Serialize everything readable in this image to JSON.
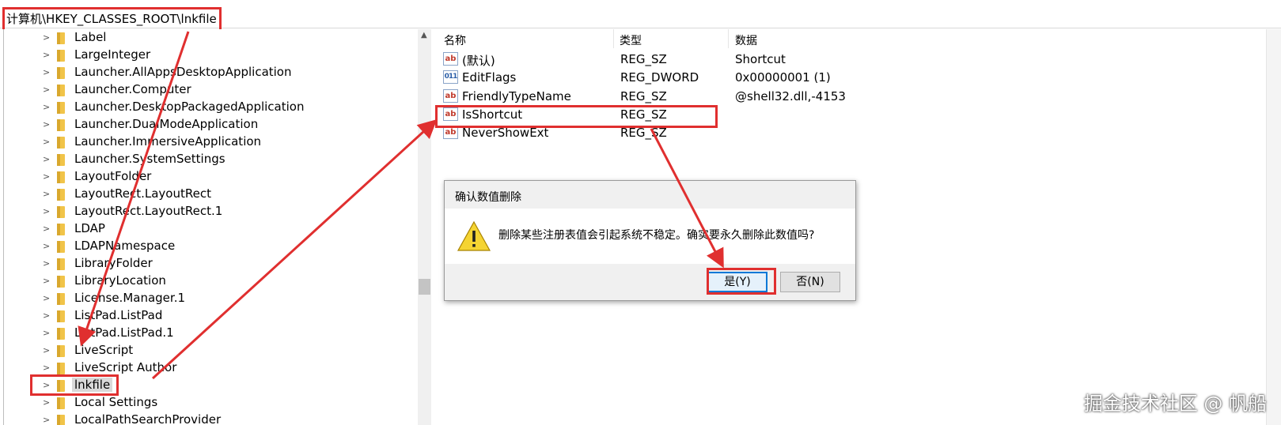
{
  "address": {
    "path": "计算机\\HKEY_CLASSES_ROOT\\lnkfile"
  },
  "tree": {
    "items": [
      {
        "label": "Label",
        "selected": false
      },
      {
        "label": "LargeInteger",
        "selected": false
      },
      {
        "label": "Launcher.AllAppsDesktopApplication",
        "selected": false
      },
      {
        "label": "Launcher.Computer",
        "selected": false
      },
      {
        "label": "Launcher.DesktopPackagedApplication",
        "selected": false
      },
      {
        "label": "Launcher.DualModeApplication",
        "selected": false
      },
      {
        "label": "Launcher.ImmersiveApplication",
        "selected": false
      },
      {
        "label": "Launcher.SystemSettings",
        "selected": false
      },
      {
        "label": "LayoutFolder",
        "selected": false
      },
      {
        "label": "LayoutRect.LayoutRect",
        "selected": false
      },
      {
        "label": "LayoutRect.LayoutRect.1",
        "selected": false
      },
      {
        "label": "LDAP",
        "selected": false
      },
      {
        "label": "LDAPNamespace",
        "selected": false
      },
      {
        "label": "LibraryFolder",
        "selected": false
      },
      {
        "label": "LibraryLocation",
        "selected": false
      },
      {
        "label": "License.Manager.1",
        "selected": false
      },
      {
        "label": "ListPad.ListPad",
        "selected": false
      },
      {
        "label": "ListPad.ListPad.1",
        "selected": false
      },
      {
        "label": "LiveScript",
        "selected": false
      },
      {
        "label": "LiveScript Author",
        "selected": false
      },
      {
        "label": "lnkfile",
        "selected": true
      },
      {
        "label": "Local Settings",
        "selected": false
      },
      {
        "label": "LocalPathSearchProvider",
        "selected": false
      }
    ]
  },
  "list": {
    "headers": {
      "name": "名称",
      "type": "类型",
      "data": "数据"
    },
    "rows": [
      {
        "icon": "ab",
        "name": "(默认)",
        "type": "REG_SZ",
        "data": "Shortcut"
      },
      {
        "icon": "011",
        "name": "EditFlags",
        "type": "REG_DWORD",
        "data": "0x00000001 (1)"
      },
      {
        "icon": "ab",
        "name": "FriendlyTypeName",
        "type": "REG_SZ",
        "data": "@shell32.dll,-4153"
      },
      {
        "icon": "ab",
        "name": "IsShortcut",
        "type": "REG_SZ",
        "data": ""
      },
      {
        "icon": "ab",
        "name": "NeverShowExt",
        "type": "REG_SZ",
        "data": ""
      }
    ]
  },
  "dialog": {
    "title": "确认数值删除",
    "message": "删除某些注册表值会引起系统不稳定。确实要永久删除此数值吗?",
    "yes_label": "是(Y)",
    "no_label": "否(N)"
  },
  "annotation_color": "#e02f2f",
  "watermark": "掘金技术社区 @ 帆船"
}
